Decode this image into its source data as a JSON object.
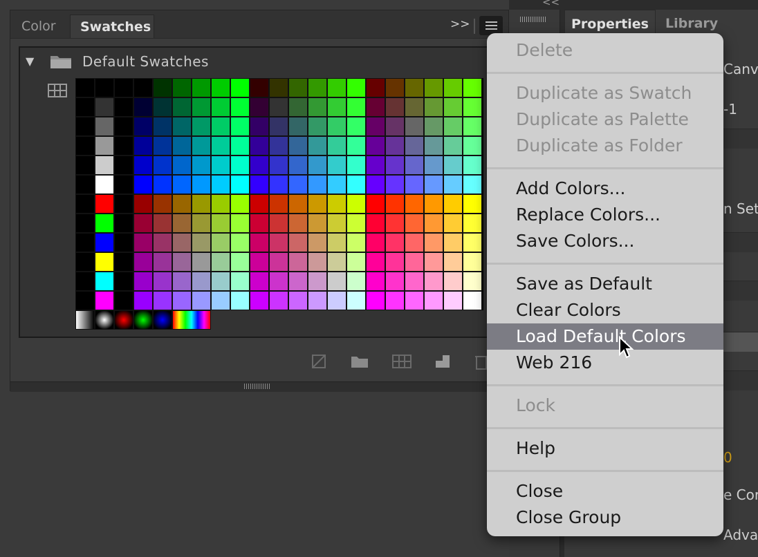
{
  "swatches_panel": {
    "tabs": [
      "Color",
      "Swatches"
    ],
    "active_tab": "Swatches",
    "folder_label": "Default Swatches",
    "palette": {
      "left_columns": [
        [
          "#000000",
          "#000000",
          "#000000",
          "#000000",
          "#000000",
          "#000000",
          "#000000",
          "#000000",
          "#000000",
          "#000000",
          "#000000",
          "#000000"
        ],
        [
          "#000000",
          "#333333",
          "#666666",
          "#999999",
          "#cccccc",
          "#ffffff",
          "#ff0000",
          "#00ff00",
          "#0000ff",
          "#ffff00",
          "#00ffff",
          "#ff00ff"
        ],
        [
          "#000000",
          "#000000",
          "#000000",
          "#000000",
          "#000000",
          "#000000",
          "#000000",
          "#000000",
          "#000000",
          "#000000",
          "#000000",
          "#000000"
        ]
      ],
      "web216_levels": [
        "00",
        "33",
        "66",
        "99",
        "cc",
        "ff"
      ]
    },
    "gradient_swatches": [
      "linear-gray",
      "radial-gray",
      "radial-red",
      "radial-green",
      "radial-blue",
      "rainbow"
    ]
  },
  "properties_panel": {
    "tabs": [
      "Properties",
      "Library"
    ],
    "active_tab": "Properties",
    "peeks": [
      "Canv",
      "-1",
      "n Set",
      "0",
      "e Cor",
      "Adva"
    ]
  },
  "menu": {
    "items": [
      {
        "label": "Delete",
        "enabled": false
      },
      {
        "label": "Duplicate as Swatch",
        "enabled": false
      },
      {
        "label": "Duplicate as Palette",
        "enabled": false
      },
      {
        "label": "Duplicate as Folder",
        "enabled": false
      },
      {
        "label": "Add Colors...",
        "enabled": true
      },
      {
        "label": "Replace Colors...",
        "enabled": true
      },
      {
        "label": "Save Colors...",
        "enabled": true
      },
      {
        "label": "Save as Default",
        "enabled": true
      },
      {
        "label": "Clear Colors",
        "enabled": true
      },
      {
        "label": "Load Default Colors",
        "enabled": true,
        "highlighted": true
      },
      {
        "label": "Web 216",
        "enabled": true
      },
      {
        "label": "Lock",
        "enabled": false
      },
      {
        "label": "Help",
        "enabled": true
      },
      {
        "label": "Close",
        "enabled": true
      },
      {
        "label": "Close Group",
        "enabled": true
      }
    ]
  },
  "colors": {
    "menu_bg": "#cfcfcf",
    "menu_highlight": "#7c7c84",
    "panel_bg": "#3b3b3b",
    "accent_peek": "#d4a017"
  }
}
